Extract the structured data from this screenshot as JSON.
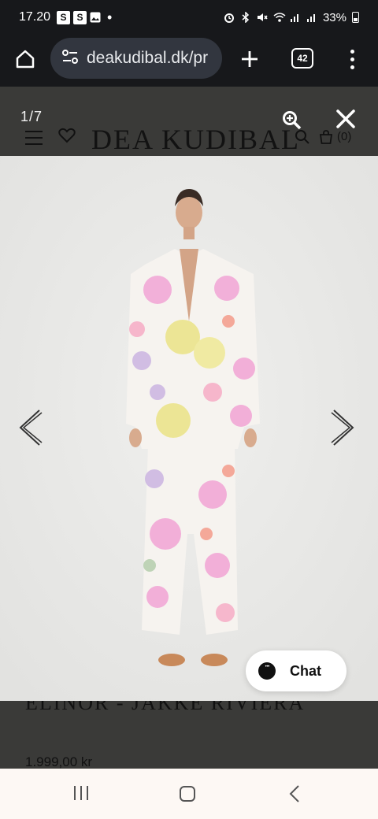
{
  "status_bar": {
    "time": "17.20",
    "badge_1": "S",
    "badge_2": "S",
    "dot": "•",
    "battery": "33%"
  },
  "browser": {
    "url": "deakudibal.dk/pr",
    "tab_count": "42"
  },
  "site": {
    "brand": "DEA KUDIBAL",
    "cart_count": "(0)"
  },
  "gallery": {
    "counter": "1/7"
  },
  "product": {
    "name": "ELINOR - JAKKE RIVIERA",
    "price": "1.999,00 kr"
  },
  "chat": {
    "label": "Chat"
  },
  "colors": {
    "photo_bg": "#e9e9e7",
    "overlay": "#3a3a38",
    "toolbar": "#17181b",
    "url_pill": "#32363f"
  },
  "icons": [
    "home-icon",
    "tune-icon",
    "plus-icon",
    "tabs-icon",
    "more-vert-icon",
    "zoom-in-icon",
    "close-icon",
    "hamburger-icon",
    "heart-icon",
    "search-icon",
    "bag-icon",
    "chevron-left-icon",
    "chevron-right-icon",
    "chat-icon"
  ]
}
